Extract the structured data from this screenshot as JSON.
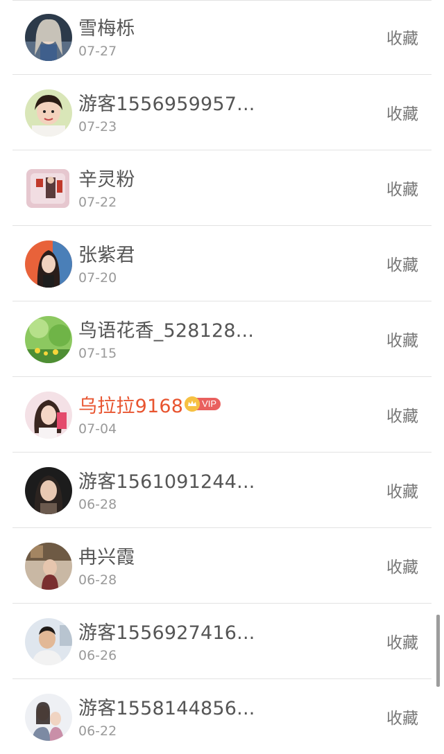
{
  "items": [
    {
      "name": "雪梅栎",
      "date": "07-27",
      "action": "收藏",
      "vip": false,
      "avatar": "woman-dark-portrait"
    },
    {
      "name": "游客1556959957...",
      "date": "07-23",
      "action": "收藏",
      "vip": false,
      "avatar": "child-portrait"
    },
    {
      "name": "辛灵粉",
      "date": "07-22",
      "action": "收藏",
      "vip": false,
      "avatar": "pillow-photo"
    },
    {
      "name": "张紫君",
      "date": "07-20",
      "action": "收藏",
      "vip": false,
      "avatar": "woman-long-hair"
    },
    {
      "name": "鸟语花香_528128...",
      "date": "07-15",
      "action": "收藏",
      "vip": false,
      "avatar": "green-flowers"
    },
    {
      "name": "乌拉拉9168",
      "date": "07-04",
      "action": "收藏",
      "vip": true,
      "vip_label": "VIP",
      "avatar": "woman-pink"
    },
    {
      "name": "游客1561091244...",
      "date": "06-28",
      "action": "收藏",
      "vip": false,
      "avatar": "woman-dark"
    },
    {
      "name": "冉兴霞",
      "date": "06-28",
      "action": "收藏",
      "vip": false,
      "avatar": "woman-indoor"
    },
    {
      "name": "游客1556927416...",
      "date": "06-26",
      "action": "收藏",
      "vip": false,
      "avatar": "man-portrait"
    },
    {
      "name": "游客1558144856...",
      "date": "06-22",
      "action": "收藏",
      "vip": false,
      "avatar": "couple-photo"
    }
  ],
  "colors": {
    "name": "#555555",
    "vip_name": "#e8542f",
    "date": "#9a9a9a",
    "action": "#777777",
    "divider": "#e2e2e2"
  }
}
